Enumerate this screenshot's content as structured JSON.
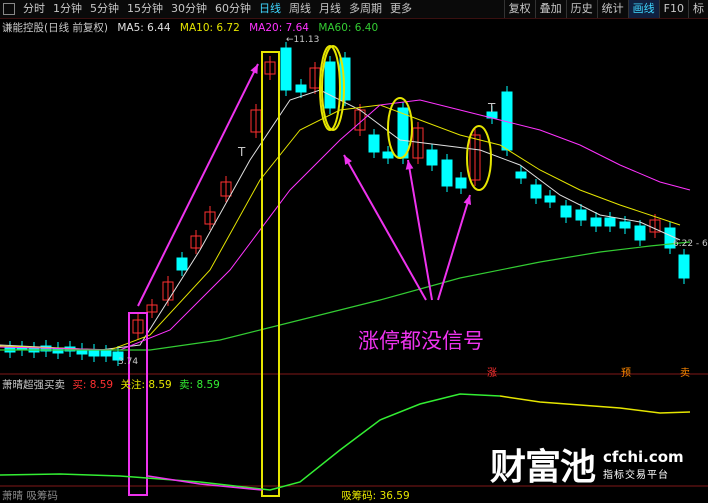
{
  "toolbar": {
    "left_items": [
      "分时",
      "1分钟",
      "5分钟",
      "15分钟",
      "30分钟",
      "60分钟",
      "日线",
      "周线",
      "月线",
      "多周期",
      "更多"
    ],
    "active_item": "日线",
    "right_items": [
      "复权",
      "叠加",
      "历史",
      "统计",
      "画线",
      "F10",
      "标"
    ],
    "selected_right": "画线"
  },
  "main_header": {
    "title": "谦能控股(日线 前复权)",
    "ma5": "MA5: 6.44",
    "ma10": "MA10: 6.72",
    "ma20": "MA20: 7.64",
    "ma60": "MA60: 6.40"
  },
  "price_labels": {
    "high": "11.13",
    "low": "3.74",
    "right": "6.22 - 6"
  },
  "annotation": "涨停都没信号",
  "signals": {
    "zhang": "涨",
    "yu": "预",
    "mai": "卖"
  },
  "sub_header": {
    "title": "萧晴超强买卖",
    "buy": "买: 8.59",
    "guanzhu": "关注: 8.59",
    "sell": "卖: 8.59"
  },
  "bottom_header": {
    "left": "萧晴 吸筹码",
    "right": "吸筹码: 36.59"
  },
  "logo": {
    "cn": "财富池",
    "domain": "cfchi.com",
    "tagline": "指标交易平台"
  },
  "colors": {
    "up": "#ff3030",
    "down": "#00ffff",
    "ma5": "#e0e0e0",
    "ma10": "#e5e500",
    "ma20": "#ff33ff",
    "ma60": "#33cc33",
    "box_yellow": "#e5e500",
    "box_magenta": "#ee33ee"
  }
}
